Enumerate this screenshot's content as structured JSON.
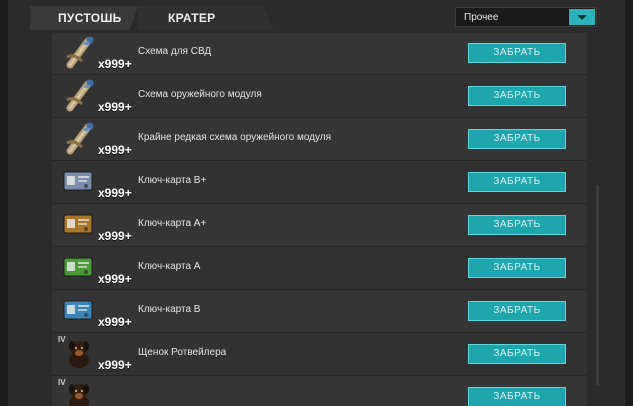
{
  "tabs": [
    {
      "label": "ПУСТОШЬ"
    },
    {
      "label": "КРАТЕР"
    }
  ],
  "filter": {
    "selected": "Прочее"
  },
  "items": [
    {
      "name": "Схема для СВД",
      "count": "x999+",
      "tier": "",
      "icon": "blueprint-icon",
      "button": "ЗАБРАТЬ"
    },
    {
      "name": "Схема оружейного модуля",
      "count": "x999+",
      "tier": "",
      "icon": "blueprint-icon",
      "button": "ЗАБРАТЬ"
    },
    {
      "name": "Крайне редкая схема оружейного модуля",
      "count": "x999+",
      "tier": "",
      "icon": "blueprint-icon",
      "button": "ЗАБРАТЬ"
    },
    {
      "name": "Ключ-карта B+",
      "count": "x999+",
      "tier": "",
      "icon": "keycard-icon",
      "button": "ЗАБРАТЬ"
    },
    {
      "name": "Ключ-карта A+",
      "count": "x999+",
      "tier": "",
      "icon": "keycard-icon",
      "button": "ЗАБРАТЬ"
    },
    {
      "name": "Ключ-карта A",
      "count": "x999+",
      "tier": "",
      "icon": "keycard-icon",
      "button": "ЗАБРАТЬ"
    },
    {
      "name": "Ключ-карта B",
      "count": "x999+",
      "tier": "",
      "icon": "keycard-icon",
      "button": "ЗАБРАТЬ"
    },
    {
      "name": "Щенок Ротвейлера",
      "count": "x999+",
      "tier": "IV",
      "icon": "puppy-icon",
      "button": "ЗАБРАТЬ"
    },
    {
      "name": "",
      "count": "",
      "tier": "IV",
      "icon": "puppy-icon",
      "button": "ЗАБРАТЬ"
    }
  ],
  "colors": {
    "accent": "#1fa5ae",
    "card_bplus": "#7a8fb0",
    "card_aplus": "#a8762a",
    "card_a": "#4a9a3a",
    "card_b": "#3a86b8"
  }
}
